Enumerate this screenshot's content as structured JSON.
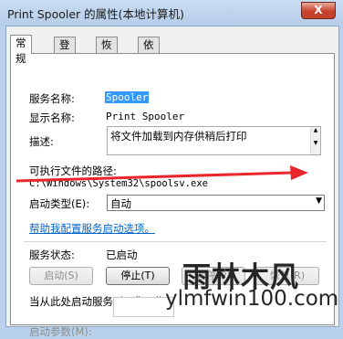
{
  "window": {
    "title": "Print Spooler 的属性(本地计算机)",
    "close_label": "X"
  },
  "tabs": [
    {
      "label": "常规"
    },
    {
      "label": "登录"
    },
    {
      "label": "恢复"
    },
    {
      "label": "依存关系"
    }
  ],
  "general": {
    "service_name_label": "服务名称:",
    "service_name_value": "Spooler",
    "display_name_label": "显示名称:",
    "display_name_value": "Print Spooler",
    "description_label": "描述:",
    "description_value": "将文件加载到内存供稍后打印",
    "exe_path_label": "可执行文件的路径:",
    "exe_path_value": "C:\\Windows\\System32\\spoolsv.exe",
    "startup_type_label": "启动类型(E):",
    "startup_type_value": "自动",
    "help_link": "帮助我配置服务启动选项。",
    "service_status_label": "服务状态:",
    "service_status_value": "已启动",
    "buttons": {
      "start": "启动(S)",
      "stop": "停止(T)",
      "pause": "暂停(P)",
      "resume": "恢复(R)"
    },
    "start_params_hint": "当从此处启动服务时，您可指",
    "start_params_label": "启动参数(M):"
  },
  "watermark": {
    "cn": "雨林木风",
    "en": "ylmfwin100.com"
  },
  "colors": {
    "accent_link": "#0066cc",
    "selection": "#3399ff",
    "arrow": "#e8262b"
  }
}
